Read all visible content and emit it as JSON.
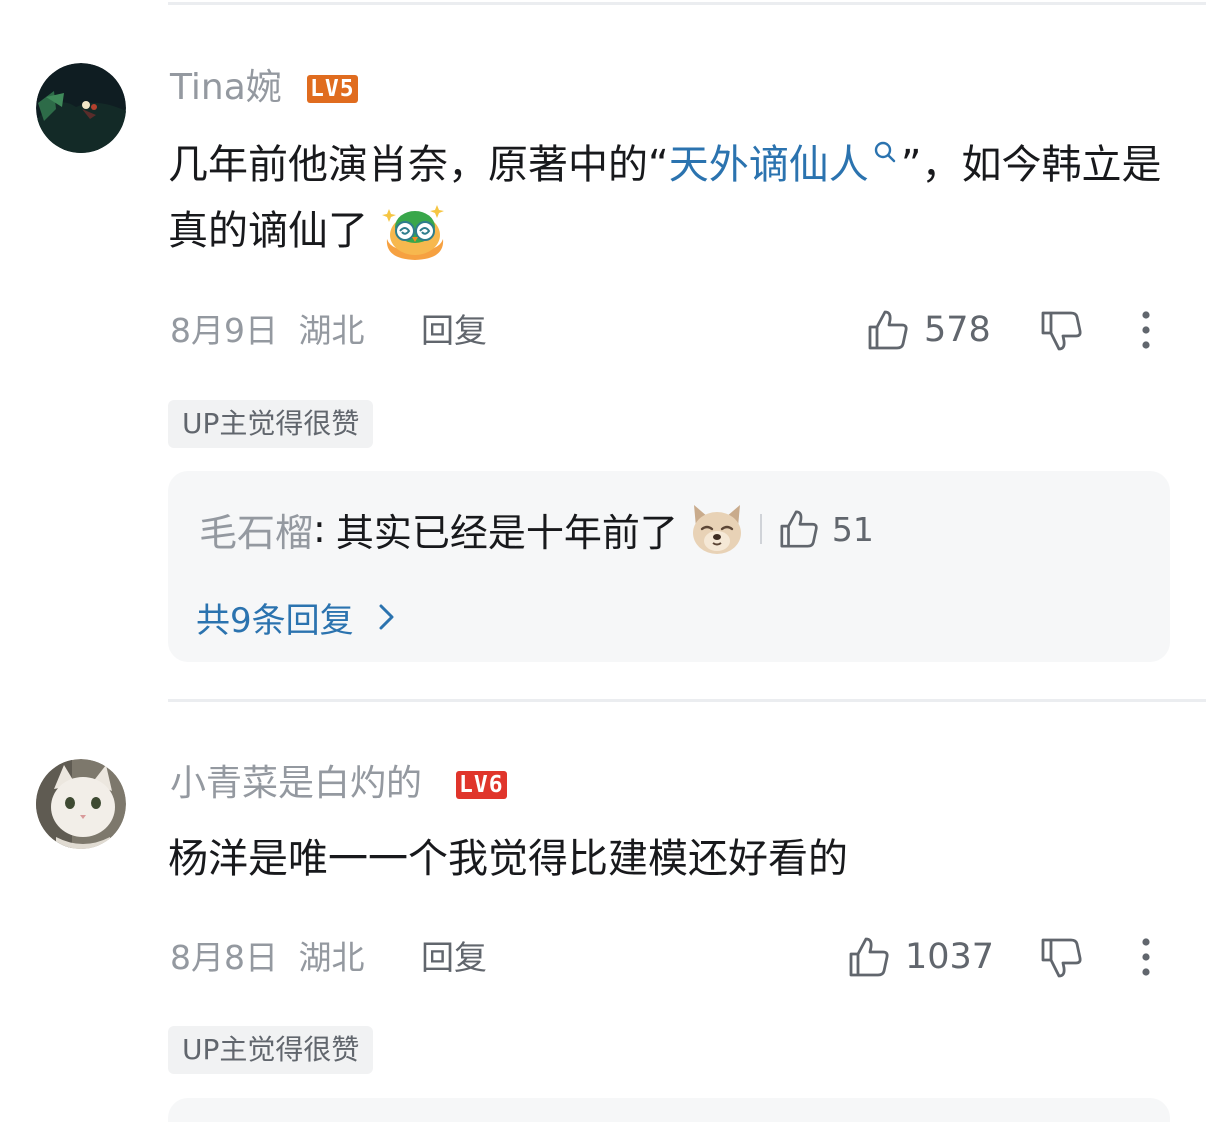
{
  "comments": [
    {
      "username": "Tina婉",
      "level": "LV5",
      "level_color": "#e06c1f",
      "avatar_icon": "night-scene-avatar-icon",
      "content_prefix": "几年前他演肖奈，原著中的“",
      "content_link": "天外谪仙人",
      "content_suffix": "”，如今韩立是真的谪仙了",
      "emoji_icon": "dizzy-owl-emoji-icon",
      "date": "8月9日",
      "location": "湖北",
      "reply_label": "回复",
      "likes": "578",
      "up_tag": "UP主觉得很赞",
      "sub_reply": {
        "username": "毛石榴",
        "colon": ":",
        "text": "其实已经是十年前了",
        "emoji_icon": "squinting-dog-emoji-icon",
        "likes": "51"
      },
      "total_replies": "共9条回复"
    },
    {
      "username": "小青菜是白灼的",
      "level": "LV6",
      "level_color": "#e0352b",
      "avatar_icon": "white-cat-avatar-icon",
      "content": "杨洋是唯一一个我觉得比建模还好看的",
      "date": "8月8日",
      "location": "湖北",
      "reply_label": "回复",
      "likes": "1037",
      "up_tag": "UP主觉得很赞"
    }
  ]
}
